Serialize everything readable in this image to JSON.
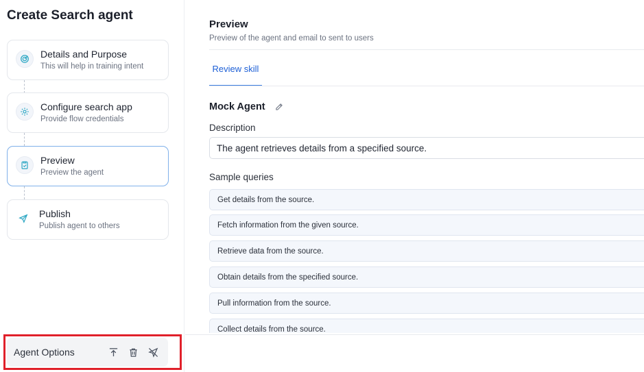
{
  "sidebar": {
    "title": "Create Search agent",
    "steps": [
      {
        "title": "Details and Purpose",
        "subtitle": "This will help in training intent",
        "icon": "target-icon"
      },
      {
        "title": "Configure search app",
        "subtitle": "Provide flow credentials",
        "icon": "gear-icon"
      },
      {
        "title": "Preview",
        "subtitle": "Preview the agent",
        "icon": "clipboard-check-icon",
        "active": true
      },
      {
        "title": "Publish",
        "subtitle": "Publish agent to others",
        "icon": "send-icon"
      }
    ],
    "options": {
      "label": "Agent Options",
      "actions": [
        "upload-icon",
        "trash-icon",
        "unpublish-icon"
      ]
    }
  },
  "main": {
    "title": "Preview",
    "subtitle": "Preview of the agent and email to sent to users",
    "tabs": [
      {
        "label": "Review skill",
        "active": true
      }
    ],
    "agent": {
      "name": "Mock Agent",
      "description_label": "Description",
      "description": "The agent retrieves details from a specified source.",
      "sample_label": "Sample queries",
      "queries": [
        "Get details from the source.",
        "Fetch information from the given source.",
        "Retrieve data from the source.",
        "Obtain details from the specified source.",
        "Pull information from the source.",
        "Collect details from the source."
      ]
    }
  },
  "colors": {
    "accent": "#1d5fd6",
    "icon_teal": "#2fa8c4",
    "highlight": "#e0202a"
  }
}
